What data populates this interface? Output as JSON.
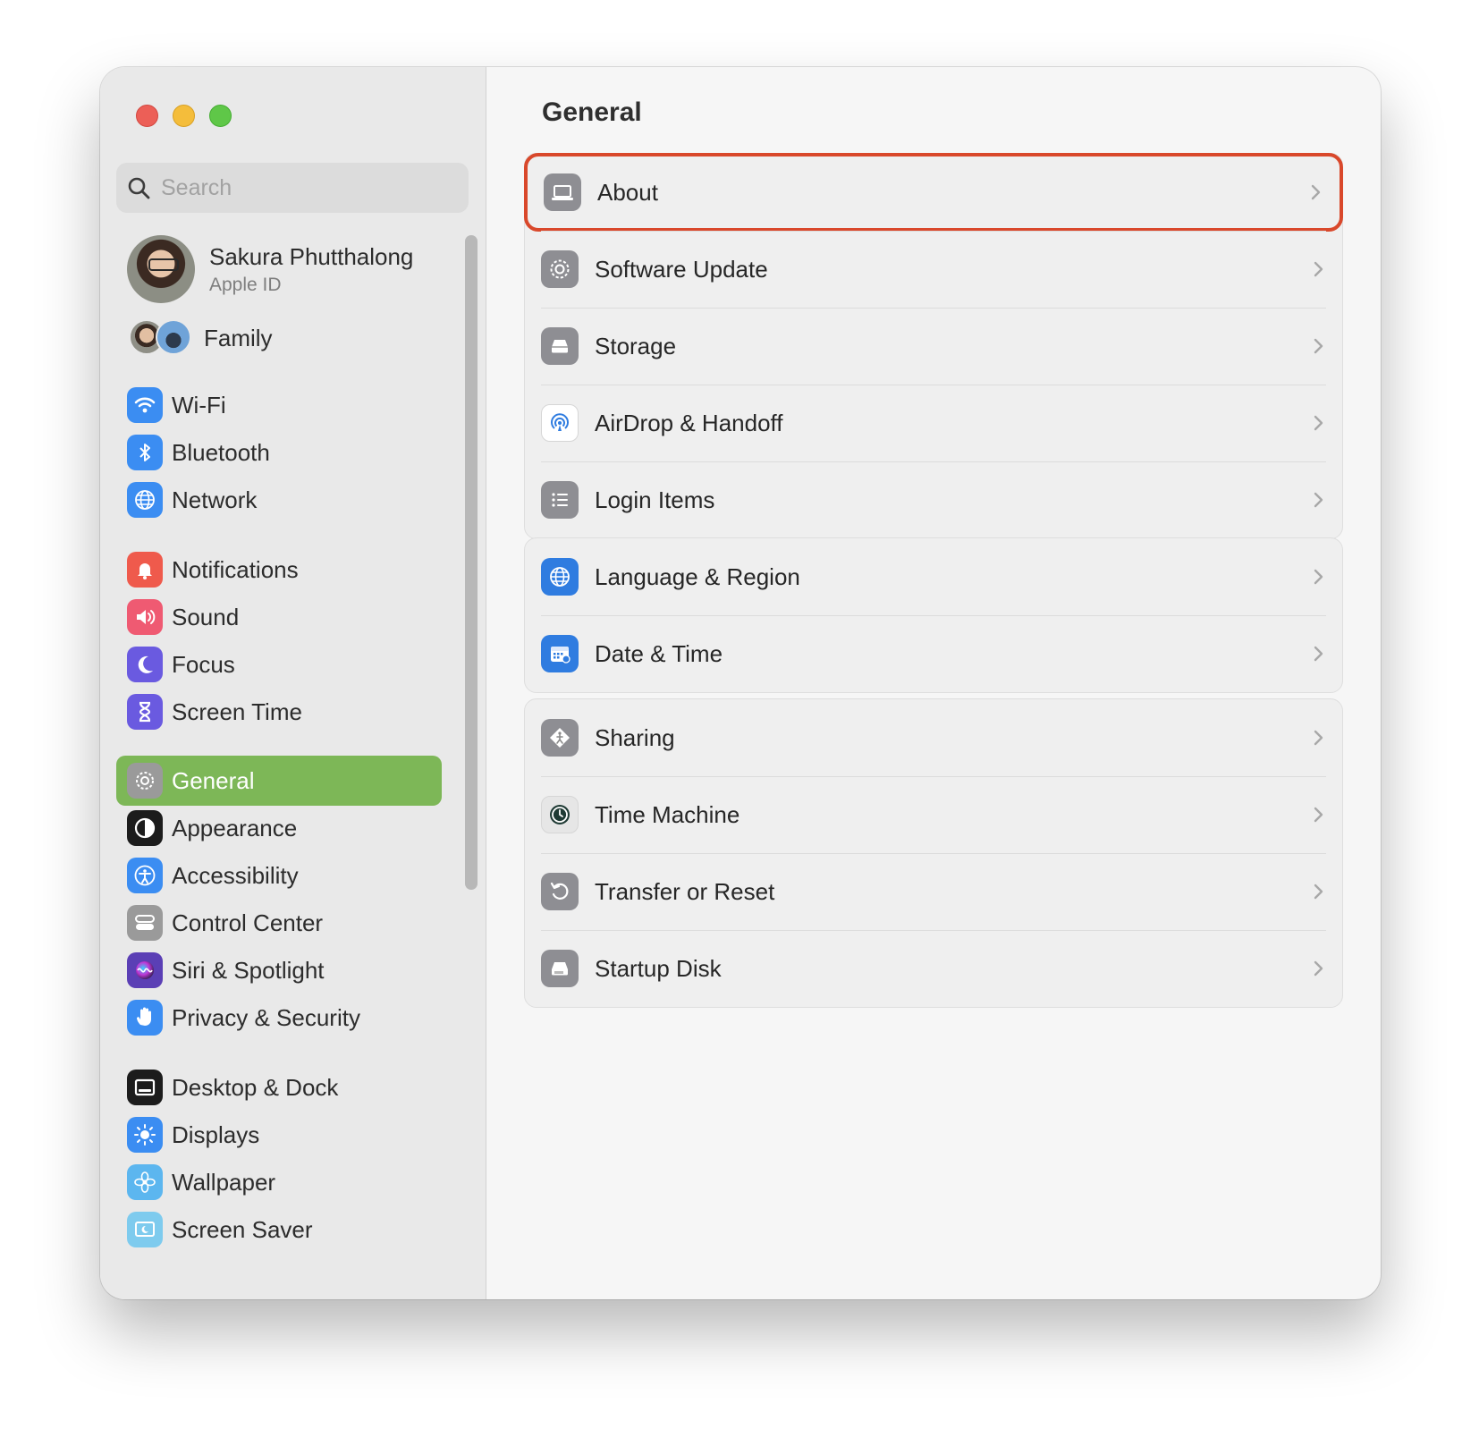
{
  "search": {
    "placeholder": "Search"
  },
  "account": {
    "name": "Sakura Phutthalong",
    "subtitle": "Apple ID",
    "family": "Family"
  },
  "sidebar": {
    "items": [
      {
        "label": "Wi-Fi",
        "icon": "wifi-icon",
        "color": "#3b8df2"
      },
      {
        "label": "Bluetooth",
        "icon": "bluetooth-icon",
        "color": "#3b8df2"
      },
      {
        "label": "Network",
        "icon": "globe-icon",
        "color": "#3b8df2"
      },
      {
        "label": "Notifications",
        "icon": "bell-icon",
        "color": "#ef5a4c"
      },
      {
        "label": "Sound",
        "icon": "speaker-icon",
        "color": "#ef5a72"
      },
      {
        "label": "Focus",
        "icon": "moon-icon",
        "color": "#6a5ae0"
      },
      {
        "label": "Screen Time",
        "icon": "hourglass-icon",
        "color": "#6a5ae0"
      },
      {
        "label": "General",
        "icon": "gear-icon",
        "color": "#9a9a9a",
        "selected": true
      },
      {
        "label": "Appearance",
        "icon": "appearance-icon",
        "color": "#1c1c1c"
      },
      {
        "label": "Accessibility",
        "icon": "accessibility-icon",
        "color": "#3b8df2"
      },
      {
        "label": "Control Center",
        "icon": "control-center-icon",
        "color": "#9a9a9a"
      },
      {
        "label": "Siri & Spotlight",
        "icon": "siri-icon",
        "color": "#5b3fb5"
      },
      {
        "label": "Privacy & Security",
        "icon": "hand-icon",
        "color": "#3b8df2"
      },
      {
        "label": "Desktop & Dock",
        "icon": "dock-icon",
        "color": "#1c1c1c"
      },
      {
        "label": "Displays",
        "icon": "sun-icon",
        "color": "#3b8df2"
      },
      {
        "label": "Wallpaper",
        "icon": "flower-icon",
        "color": "#5cb6ef"
      },
      {
        "label": "Screen Saver",
        "icon": "screen-saver-icon",
        "color": "#7ecbee"
      }
    ]
  },
  "main": {
    "title": "General",
    "groups": [
      [
        {
          "label": "About",
          "icon": "laptop-icon",
          "highlighted": true
        },
        {
          "label": "Software Update",
          "icon": "gear-icon"
        },
        {
          "label": "Storage",
          "icon": "drive-icon"
        },
        {
          "label": "AirDrop & Handoff",
          "icon": "airdrop-icon"
        },
        {
          "label": "Login Items",
          "icon": "list-icon"
        }
      ],
      [
        {
          "label": "Language & Region",
          "icon": "globe-icon"
        },
        {
          "label": "Date & Time",
          "icon": "calendar-icon"
        }
      ],
      [
        {
          "label": "Sharing",
          "icon": "sharing-icon"
        },
        {
          "label": "Time Machine",
          "icon": "time-machine-icon"
        },
        {
          "label": "Transfer or Reset",
          "icon": "reset-icon"
        },
        {
          "label": "Startup Disk",
          "icon": "disk-icon"
        }
      ]
    ]
  },
  "colors": {
    "accent_selection": "#7db757",
    "highlight_border": "#d9482b"
  }
}
